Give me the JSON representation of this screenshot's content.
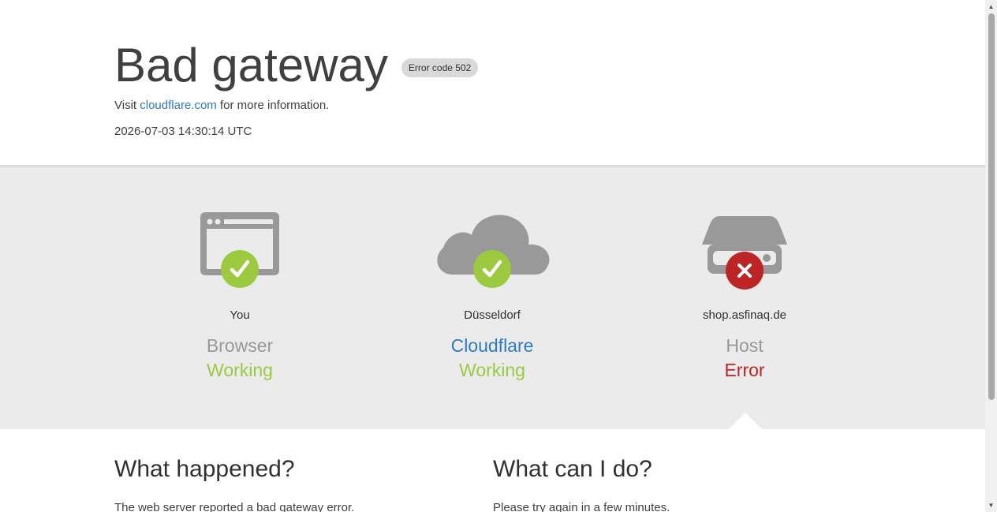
{
  "header": {
    "title": "Bad gateway",
    "error_badge": "Error code 502",
    "visit_prefix": "Visit",
    "visit_link": "cloudflare.com",
    "visit_suffix": "for more information.",
    "timestamp": "2026-07-03 14:30:14 UTC"
  },
  "status": {
    "columns": [
      {
        "location": "You",
        "role": "Browser",
        "state": "Working",
        "icon": "browser-icon",
        "status_icon": "check-icon"
      },
      {
        "location": "Düsseldorf",
        "role": "Cloudflare",
        "state": "Working",
        "icon": "cloud-icon",
        "status_icon": "check-icon"
      },
      {
        "location": "shop.asfinaq.de",
        "role": "Host",
        "state": "Error",
        "icon": "server-icon",
        "status_icon": "error-x-icon"
      }
    ],
    "colors": {
      "working": "#9bca3e",
      "error": "#bd2426",
      "link": "#2f7bbf",
      "icon_gray": "#999999"
    }
  },
  "bottom": {
    "what_happened_title": "What happened?",
    "what_happened_text": "The web server reported a bad gateway error.",
    "what_can_i_do_title": "What can I do?",
    "what_can_i_do_text": "Please try again in a few minutes."
  },
  "scrollbar": {
    "up_icon": "scroll-up-arrow-icon",
    "down_icon": "scroll-down-arrow-icon"
  }
}
